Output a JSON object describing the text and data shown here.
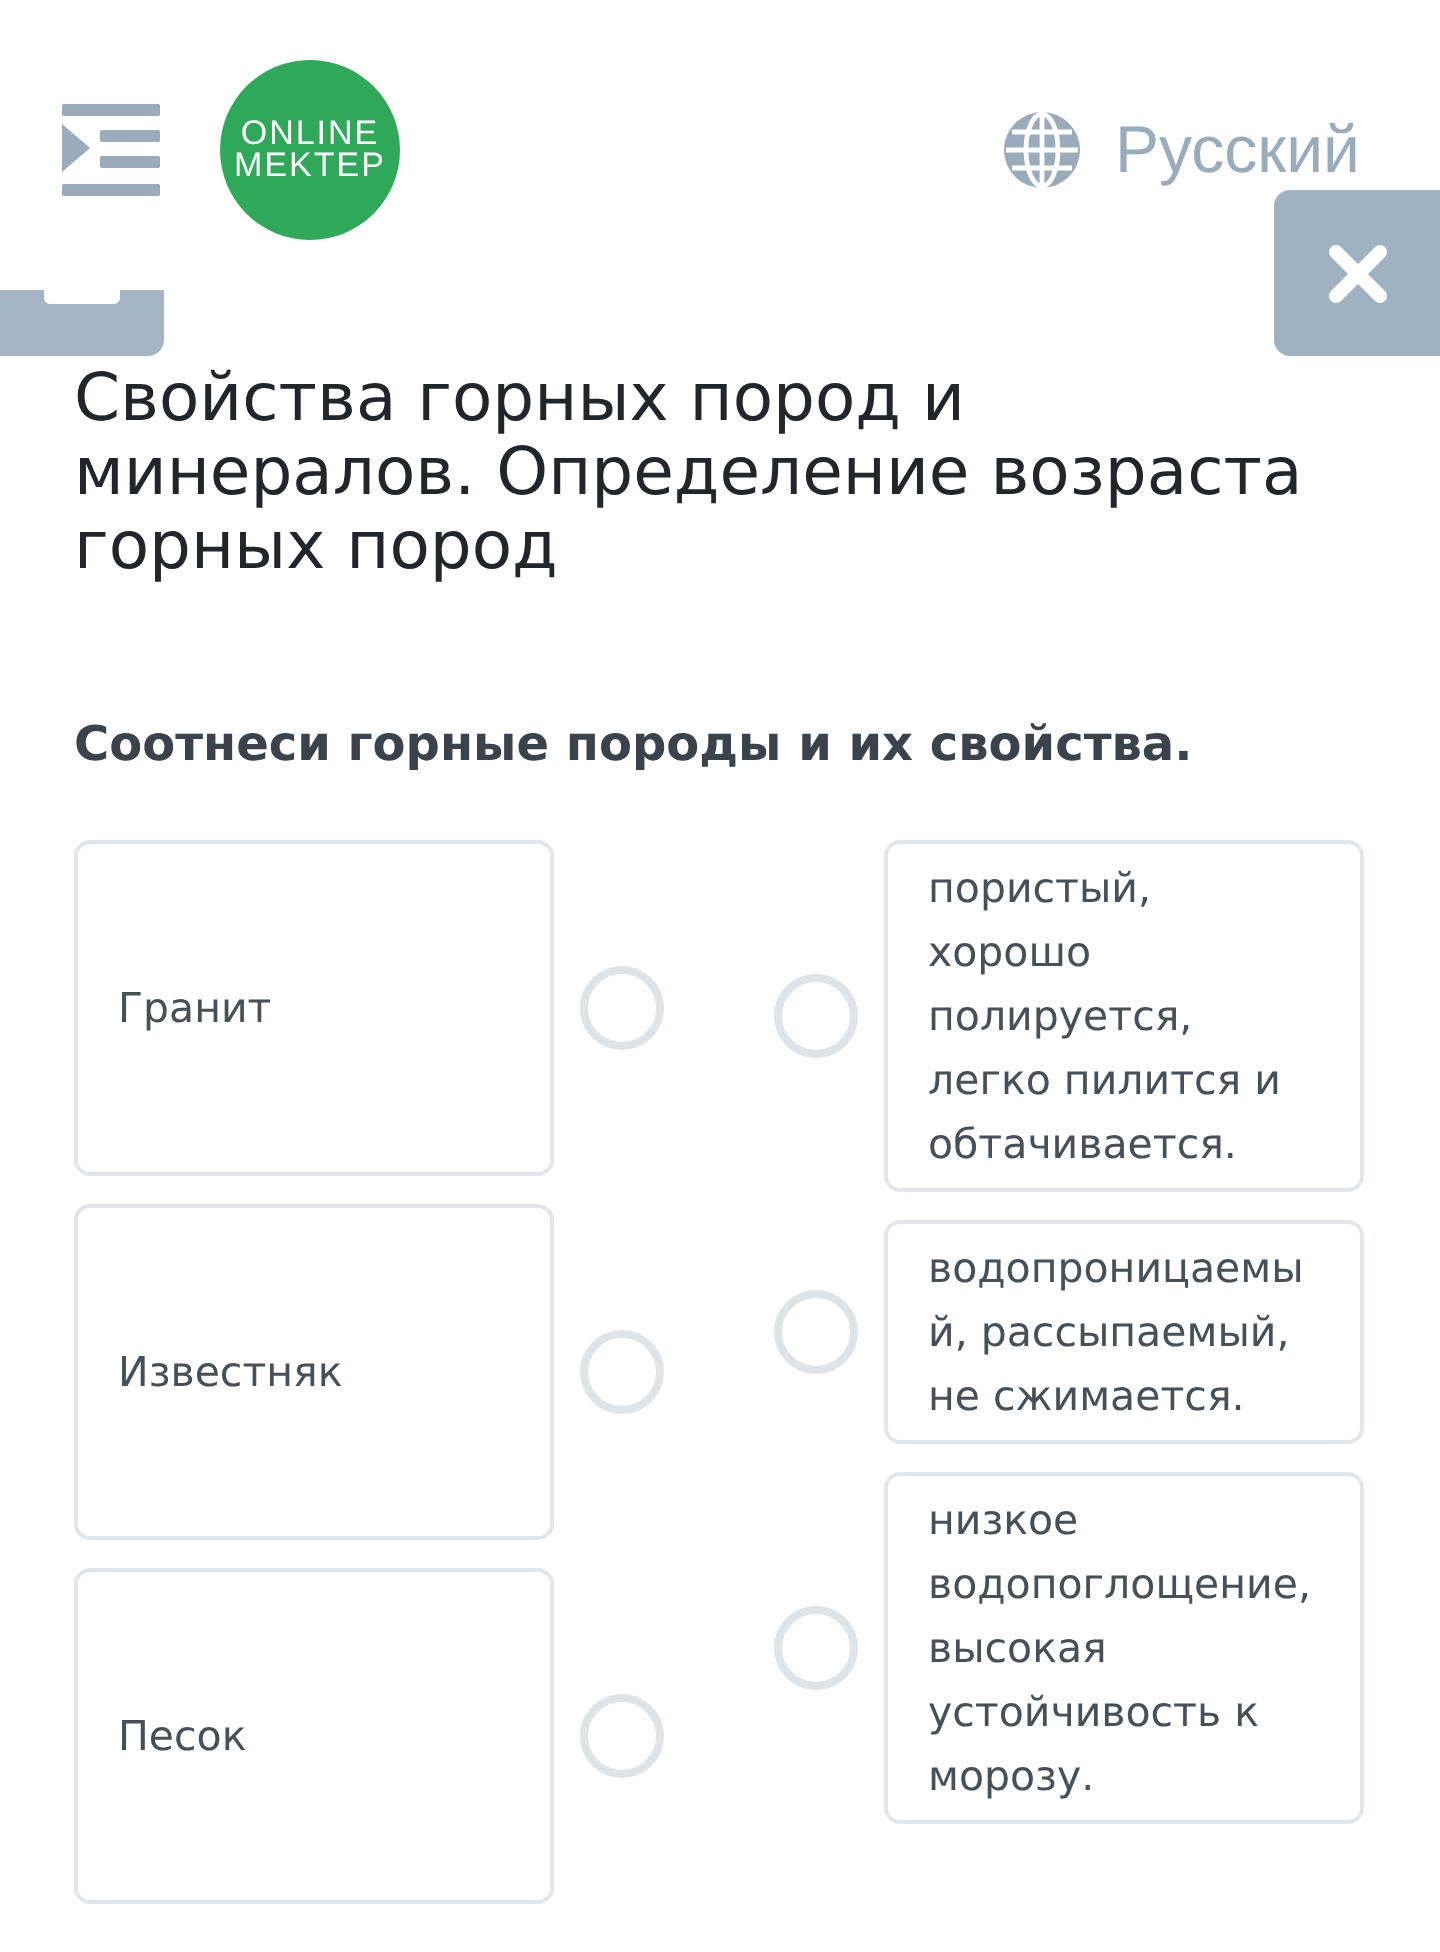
{
  "header": {
    "logo": [
      "ONLINE",
      "MEKTEP"
    ],
    "language": "Русский"
  },
  "title": "Свойства горных пород и минералов. Определение возраста горных пород",
  "question": "Соотнеси горные породы и их свойства.",
  "left_items": [
    {
      "text": "Гранит"
    },
    {
      "text": "Известняк"
    },
    {
      "text": "Песок"
    }
  ],
  "right_items": [
    {
      "text": "пористый, хорошо полируется, легко пилится и обтачивается."
    },
    {
      "text": "водопроницаемый, рассыпаемый, не сжимается."
    },
    {
      "text": "низкое водопоглощение, высокая устойчивость к морозу."
    }
  ]
}
